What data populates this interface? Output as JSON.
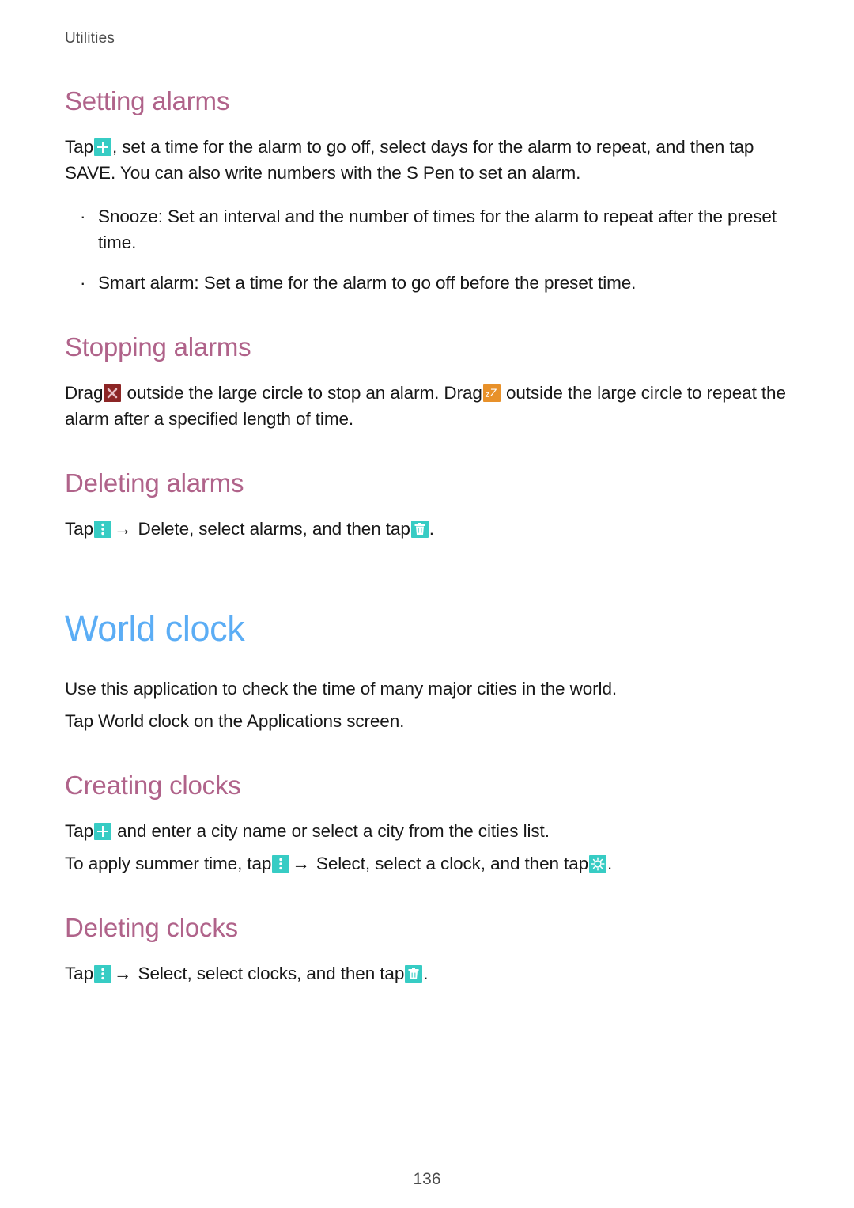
{
  "header": {
    "running_title": "Utilities"
  },
  "sections": [
    {
      "id": "setting-alarms",
      "heading": "Setting alarms",
      "paragraph_pre": "Tap",
      "paragraph_post": ", set a time for the alarm to go off, select days for the alarm to repeat, and then tap SAVE. You can also write numbers with the S Pen to set an alarm.",
      "bullets": [
        {
          "bullet": "·",
          "label": "Snooze",
          "separator": ":",
          "text": " Set an interval and the number of times for the alarm to repeat after the preset time."
        },
        {
          "bullet": "·",
          "label": "Smart alarm",
          "separator": ":",
          "text": " Set a time for the alarm to go off before the preset time."
        }
      ]
    },
    {
      "id": "stopping-alarms",
      "heading": "Stopping alarms",
      "text_a": "Drag",
      "text_b": " outside the large circle to stop an alarm. Drag",
      "text_c": " outside the large circle to repeat the alarm after a specified length of time."
    },
    {
      "id": "deleting-alarms",
      "heading": "Deleting alarms",
      "text_a": "Tap",
      "arrow": "→",
      "text_b": " Delete, select alarms, and then tap",
      "text_c": "."
    }
  ],
  "world_clock": {
    "heading": "World clock",
    "intro": "Use this application to check the time of many major cities in the world.",
    "tap_line_a": "Tap ",
    "tap_line_b": "World clock",
    "tap_line_c": " on the Applications screen.",
    "creating": {
      "heading": "Creating clocks",
      "line1_a": "Tap",
      "line1_b": " and enter a city name or select a city from the cities list.",
      "line2_a": "To apply summer time, tap",
      "line2_arrow": "→",
      "line2_b": " Select, select a clock, and then tap",
      "line2_c": "."
    },
    "deleting": {
      "heading": "Deleting clocks",
      "line_a": "Tap",
      "arrow": "→",
      "line_b": " Select, select clocks, and then tap",
      "line_c": "."
    }
  },
  "icons": {
    "add": "add-icon",
    "menu": "more-options-icon",
    "trash": "delete-icon",
    "dismiss": "dismiss-alarm-icon",
    "snooze": "snooze-icon",
    "summer_time": "summer-time-icon"
  },
  "colors": {
    "heading_blue": "#5badf5",
    "subheading_mauve": "#b0638a",
    "icon_teal": "#37ccc4",
    "icon_maroon": "#8c2525",
    "icon_orange": "#e8912a",
    "body_text": "#181818",
    "header_gray": "#4a4a4a"
  },
  "footer": {
    "page_number": "136"
  }
}
